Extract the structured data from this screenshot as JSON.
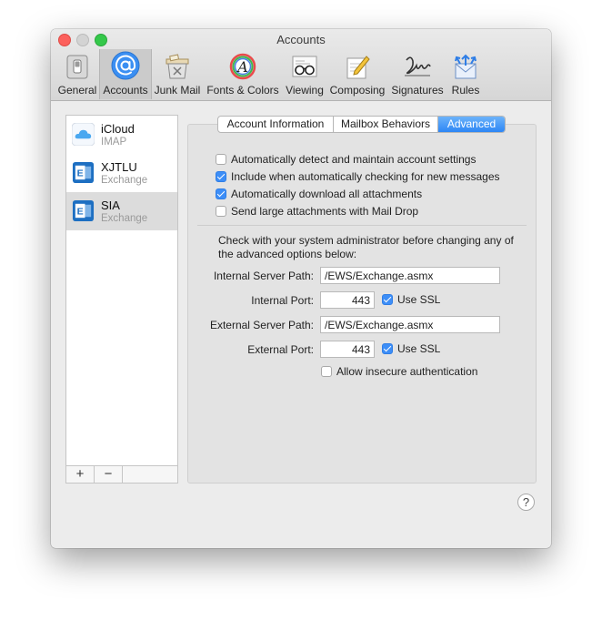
{
  "window": {
    "title": "Accounts"
  },
  "toolbar": {
    "items": [
      {
        "label": "General",
        "icon": "general-switch-icon"
      },
      {
        "label": "Accounts",
        "icon": "at-sign-icon",
        "active": true
      },
      {
        "label": "Junk Mail",
        "icon": "trash-bin-icon"
      },
      {
        "label": "Fonts & Colors",
        "icon": "font-color-icon"
      },
      {
        "label": "Viewing",
        "icon": "glasses-icon"
      },
      {
        "label": "Composing",
        "icon": "pencil-paper-icon"
      },
      {
        "label": "Signatures",
        "icon": "signature-icon"
      },
      {
        "label": "Rules",
        "icon": "rules-envelope-icon"
      }
    ]
  },
  "accounts": [
    {
      "name": "iCloud",
      "type": "IMAP",
      "icon": "cloud-icon"
    },
    {
      "name": "XJTLU",
      "type": "Exchange",
      "icon": "exchange-icon"
    },
    {
      "name": "SIA",
      "type": "Exchange",
      "icon": "exchange-icon",
      "selected": true
    }
  ],
  "sidebar_buttons": {
    "add": "+",
    "remove": "−"
  },
  "tabs": [
    {
      "label": "Account Information"
    },
    {
      "label": "Mailbox Behaviors"
    },
    {
      "label": "Advanced",
      "active": true
    }
  ],
  "options": [
    {
      "label": "Automatically detect and maintain account settings",
      "checked": false
    },
    {
      "label": "Include when automatically checking for new messages",
      "checked": true
    },
    {
      "label": "Automatically download all attachments",
      "checked": true
    },
    {
      "label": "Send large attachments with Mail Drop",
      "checked": false
    }
  ],
  "note": "Check with your system administrator before changing any of the advanced options below:",
  "server": {
    "internal_path_label": "Internal Server Path:",
    "internal_path_value": "/EWS/Exchange.asmx",
    "internal_port_label": "Internal Port:",
    "internal_port_value": "443",
    "internal_ssl_label": "Use SSL",
    "internal_ssl_checked": true,
    "external_path_label": "External Server Path:",
    "external_path_value": "/EWS/Exchange.asmx",
    "external_port_label": "External Port:",
    "external_port_value": "443",
    "external_ssl_label": "Use SSL",
    "external_ssl_checked": true,
    "insecure_auth_label": "Allow insecure authentication",
    "insecure_auth_checked": false
  },
  "help_button": "?",
  "colors": {
    "accent": "#3d8ef7",
    "selected_row": "#dcdcdc"
  }
}
